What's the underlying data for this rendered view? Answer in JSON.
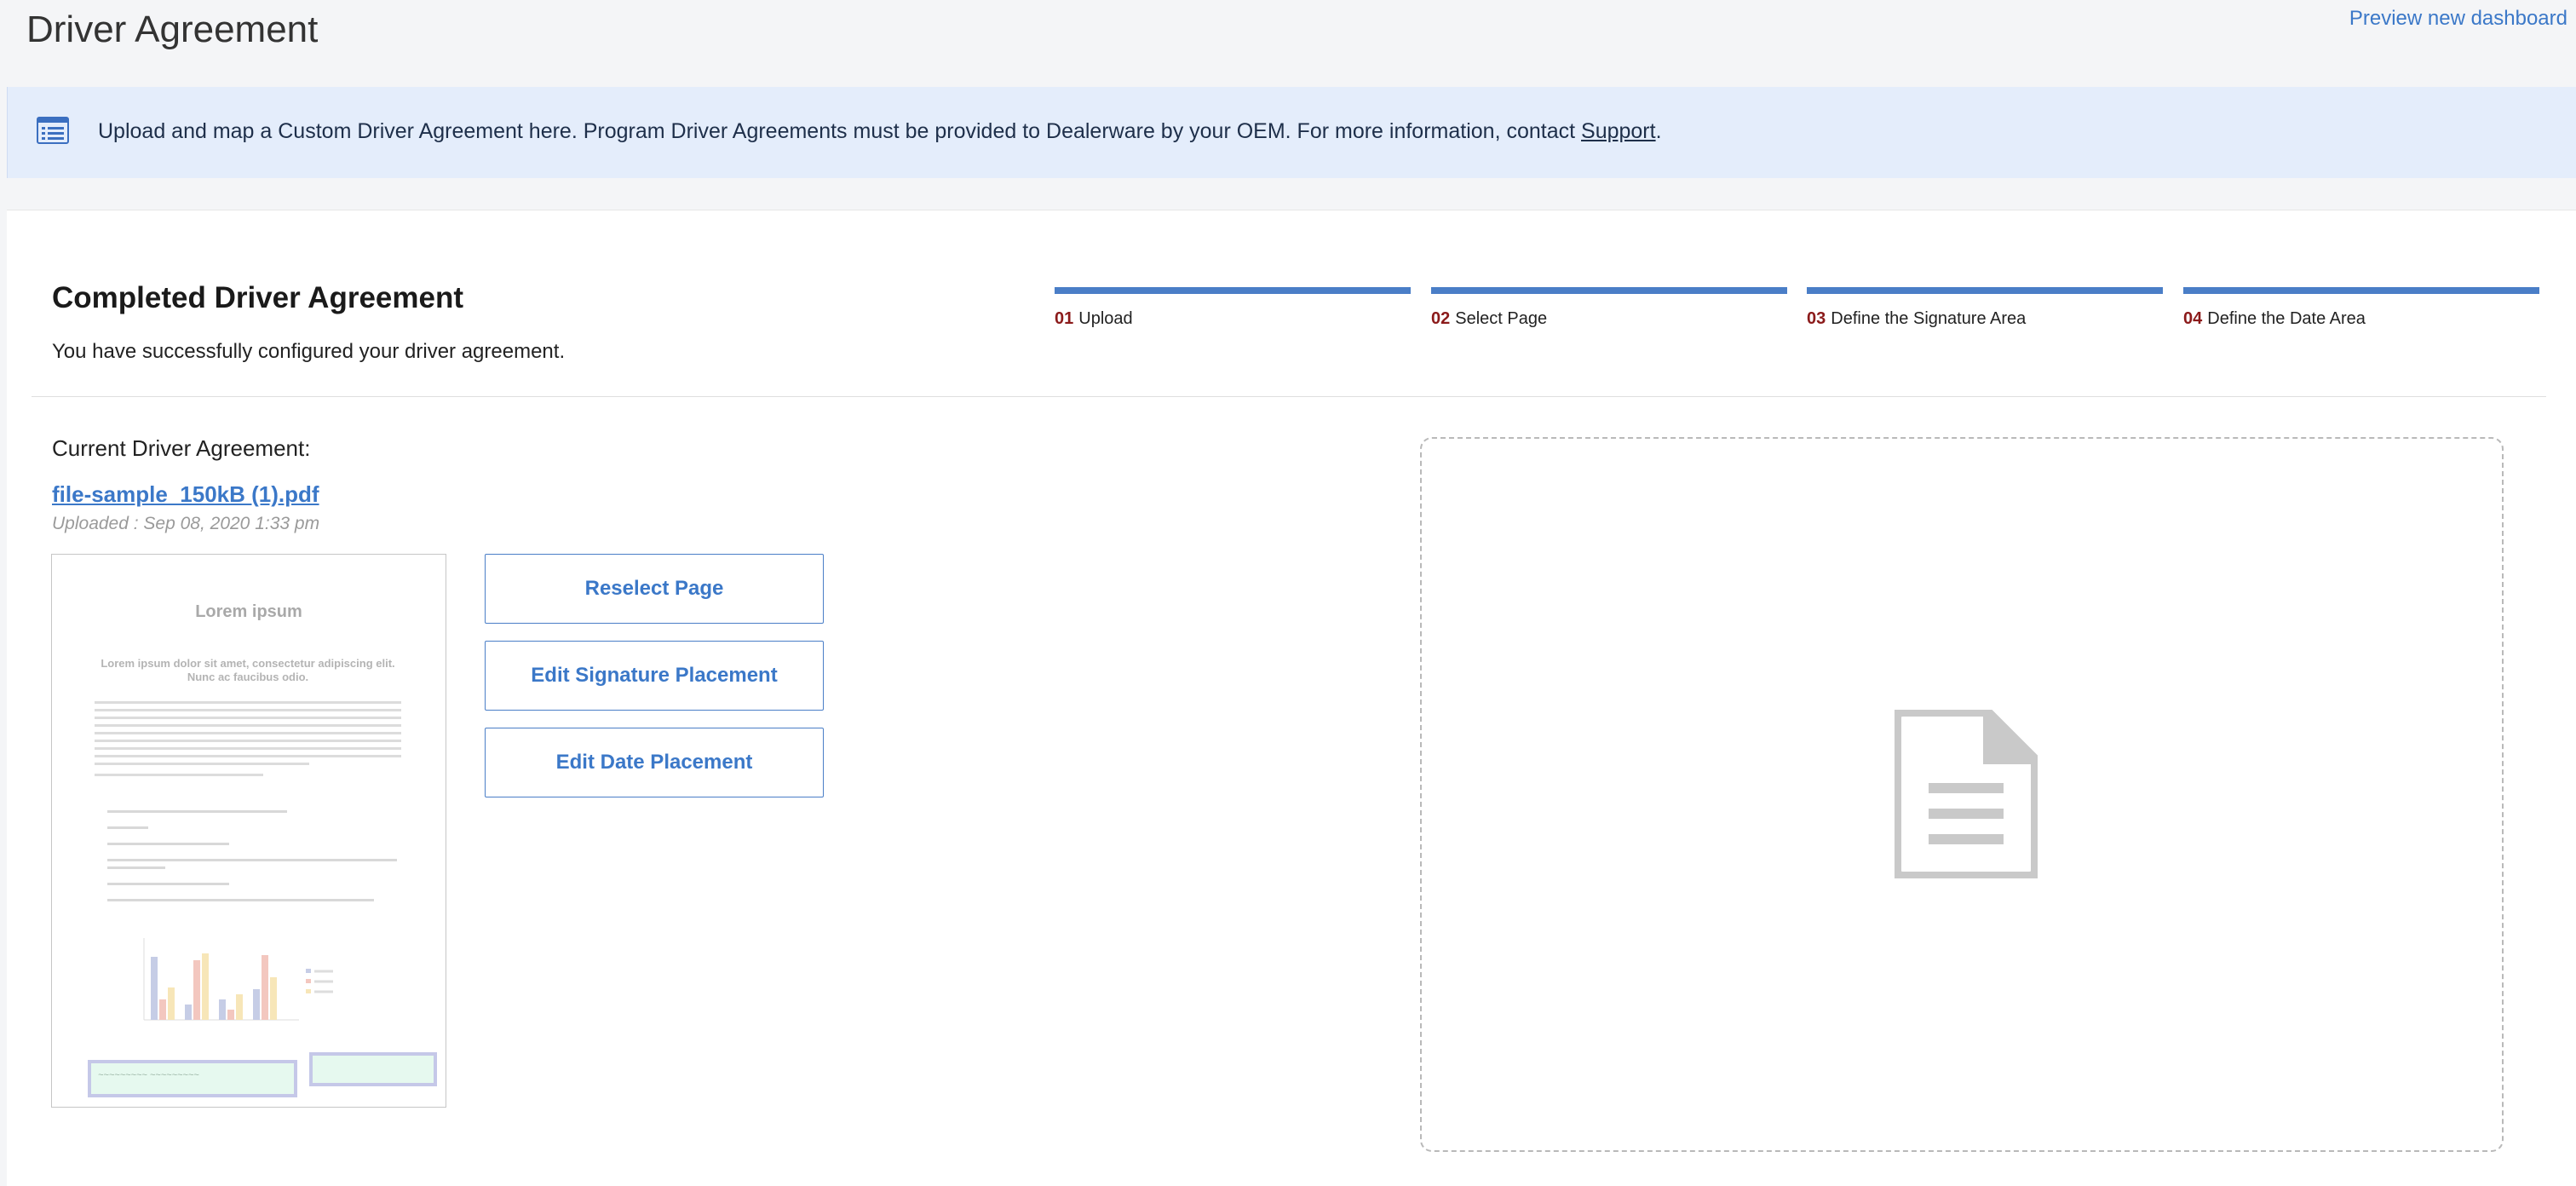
{
  "header": {
    "title": "Driver Agreement",
    "preview_link": "Preview new dashboard"
  },
  "banner": {
    "icon": "list-card-icon",
    "text": "Upload and map a Custom Driver Agreement here. Program Driver Agreements must be provided to Dealerware by your OEM. For more information, contact ",
    "link": "Support",
    "suffix": "."
  },
  "card": {
    "title": "Completed Driver Agreement",
    "subtitle": "You have successfully configured your driver agreement."
  },
  "steps": [
    {
      "num": "01",
      "label": "Upload"
    },
    {
      "num": "02",
      "label": "Select Page"
    },
    {
      "num": "03",
      "label": "Define the Signature Area"
    },
    {
      "num": "04",
      "label": "Define the Date Area"
    }
  ],
  "current": {
    "label": "Current Driver Agreement:",
    "file_name": "file-sample_150kB (1).pdf",
    "uploaded": "Uploaded : Sep 08, 2020 1:33 pm"
  },
  "preview": {
    "title": "Lorem ipsum",
    "subtitle": "Lorem ipsum dolor sit amet, consectetur adipiscing elit. Nunc ac faucibus odio."
  },
  "actions": {
    "reselect": "Reselect Page",
    "edit_signature": "Edit Signature Placement",
    "edit_date": "Edit Date Placement"
  },
  "dropzone": {
    "icon": "document-icon"
  },
  "colors": {
    "accent": "#4a7ec7",
    "link": "#3b78c8",
    "step_number": "#8b1a1a",
    "banner_bg": "#e4edfb"
  }
}
